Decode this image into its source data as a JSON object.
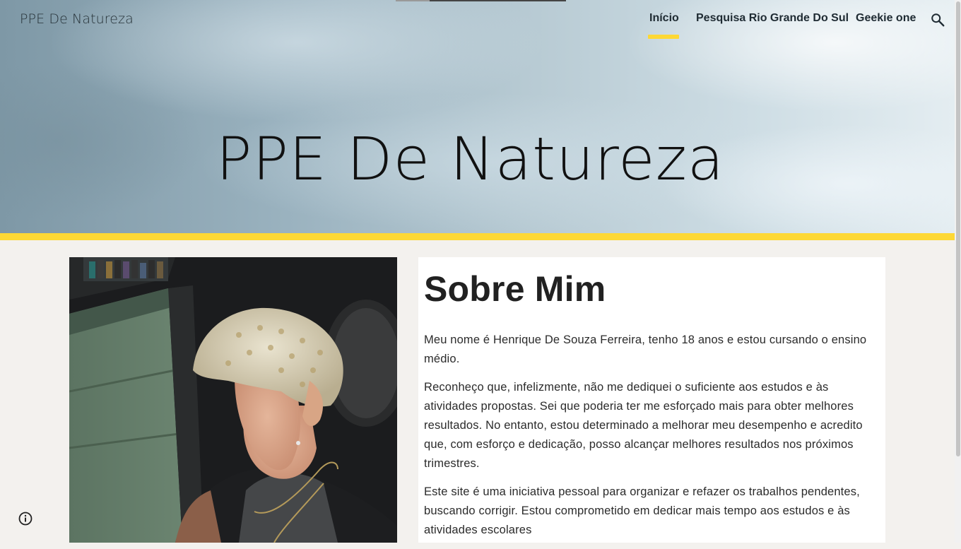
{
  "site": {
    "title": "PPE De Natureza"
  },
  "nav": {
    "items": [
      {
        "label": "Início",
        "active": true
      },
      {
        "label": "Pesquisa Rio Grande Do Sul",
        "active": false
      },
      {
        "label": "Geekie one",
        "active": false
      }
    ],
    "search_icon": "search-icon"
  },
  "hero": {
    "heading": "PPE De Natureza",
    "accent_color": "#fdd835"
  },
  "about": {
    "heading": "Sobre Mim",
    "paragraphs": [
      "Meu nome é Henrique De Souza Ferreira, tenho 18 anos e estou cursando o ensino médio.",
      "Reconheço que, infelizmente, não me dediquei o suficiente aos estudos e às atividades propostas. Sei que poderia ter me esforçado mais para obter melhores resultados. No entanto, estou determinado a melhorar meu desempenho e acredito que, com esforço e dedicação, posso alcançar melhores resultados nos próximos trimestres.",
      "Este site é uma iniciativa pessoal para organizar e refazer os trabalhos pendentes, buscando corrigir. Estou comprometido em dedicar mais tempo aos estudos e às atividades escolares"
    ]
  },
  "footer": {
    "info_icon": "info-icon"
  },
  "colors": {
    "accent": "#fdd835",
    "page_background": "#f3f1ee",
    "text": "#212121"
  }
}
